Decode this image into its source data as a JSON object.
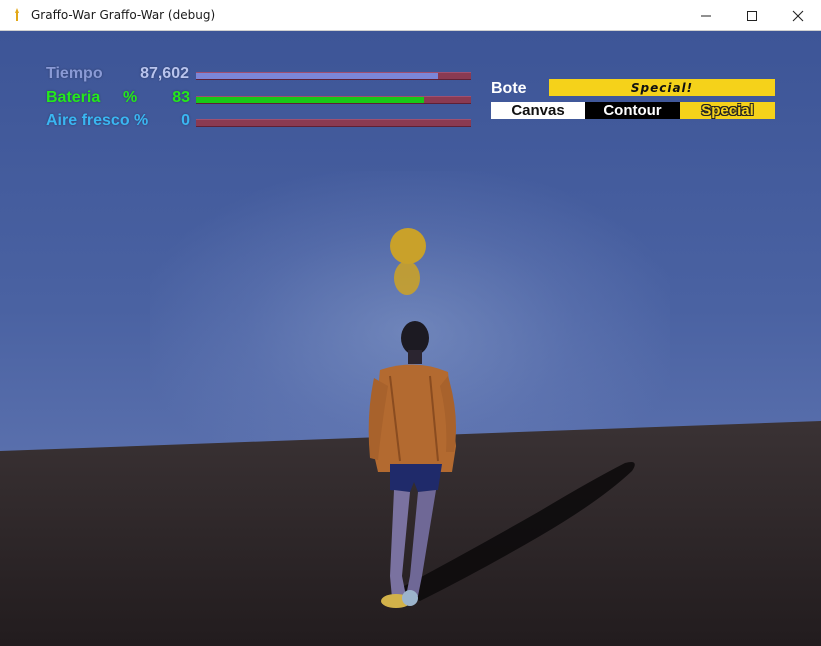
{
  "window": {
    "title": "Graffo-War Graffo-War (debug)",
    "app_icon": "graffo-war-app-icon",
    "controls": [
      "minimize-icon",
      "maximize-icon",
      "close-icon"
    ]
  },
  "hud": {
    "stats": [
      {
        "label": "Tiempo",
        "value": "87,602",
        "fill": 0.88,
        "label_color": "#8a9ad6",
        "value_color": "#b9c4ee",
        "fill_color": "#7b86d8"
      },
      {
        "label": "Bateria",
        "unit": "%",
        "value": "83",
        "fill": 0.83,
        "label_color": "#25e81c",
        "value_color": "#25e81c",
        "fill_color": "#18c818"
      },
      {
        "label": "Aire fresco %",
        "value": "0",
        "fill": 0.0,
        "label_color": "#3ab6f2",
        "value_color": "#3ab6f2",
        "fill_color": "#3ab6f2"
      }
    ],
    "bar_track_color": "#8a3a52",
    "bote": {
      "label": "Bote",
      "mode_banner": "Special!",
      "tabs": [
        "Canvas",
        "Contour",
        "Special"
      ]
    }
  },
  "scene": {
    "sky_color": "#4a62a2",
    "ground_color": "#2a2426",
    "spray_color": "#c9a12a"
  }
}
